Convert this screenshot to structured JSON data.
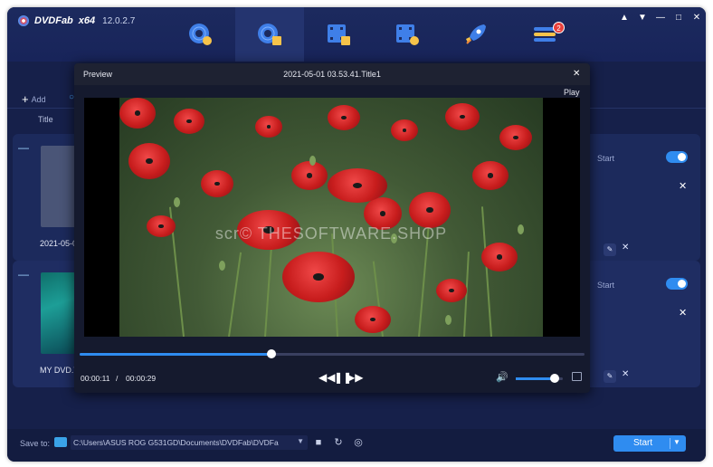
{
  "app": {
    "logo_text": "DVDFab",
    "arch": "x64",
    "version": "12.0.2.7"
  },
  "window_controls": [
    "shirt-icon",
    "menu-icon",
    "minimize-icon",
    "maximize-icon",
    "close-icon"
  ],
  "modes": [
    {
      "name": "copy",
      "icon": "disc-copy-icon",
      "active": false
    },
    {
      "name": "ripper",
      "icon": "disc-rip-icon",
      "active": true
    },
    {
      "name": "converter",
      "icon": "video-convert-icon",
      "active": false
    },
    {
      "name": "creator",
      "icon": "video-create-icon",
      "active": false
    },
    {
      "name": "utilities",
      "icon": "rocket-icon",
      "active": false
    },
    {
      "name": "task-queue",
      "icon": "queue-icon",
      "active": false,
      "badge": "2"
    }
  ],
  "toolbar": {
    "add_label": "Add"
  },
  "list": {
    "title_header": "Title"
  },
  "cards": [
    {
      "title": "2021-05-0",
      "start_label": "Start"
    },
    {
      "title": "MY DVD.T",
      "start_label": "Start"
    }
  ],
  "preview": {
    "label": "Preview",
    "title": "2021-05-01 03.53.41.Title1",
    "play_label": "Play",
    "watermark": "scr© THESOFTWARE.SHOP",
    "current_time": "00:00:11",
    "separator": "/",
    "total_time": "00:00:29",
    "progress": 0.38,
    "volume": 0.82
  },
  "bottom": {
    "save_label": "Save to:",
    "path": "C:\\Users\\ASUS ROG G531GD\\Documents\\DVDFab\\DVDFa",
    "start_label": "Start"
  },
  "colors": {
    "accent": "#2f8cf0",
    "background": "#16204a",
    "badge": "#e8413c"
  }
}
